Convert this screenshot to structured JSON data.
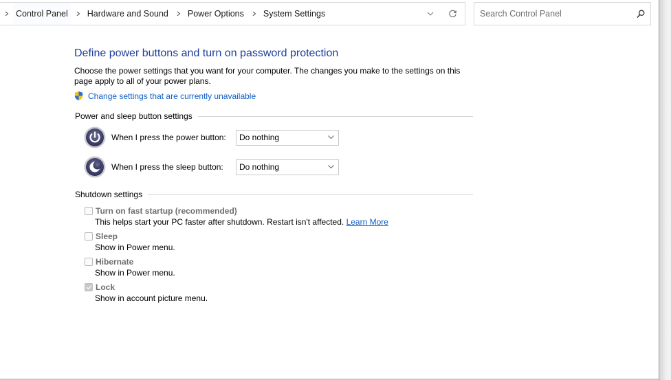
{
  "address_bar": {
    "breadcrumbs": [
      "Control Panel",
      "Hardware and Sound",
      "Power Options",
      "System Settings"
    ],
    "dropdown_icon": "chevron-down-icon",
    "refresh_icon": "refresh-icon"
  },
  "search": {
    "placeholder": "Search Control Panel",
    "value": "",
    "icon": "search-icon"
  },
  "page": {
    "title": "Define power buttons and turn on password protection",
    "description": "Choose the power settings that you want for your computer. The changes you make to the settings on this page apply to all of your power plans.",
    "uac_link": "Change settings that are currently unavailable"
  },
  "power_sleep": {
    "header": "Power and sleep button settings",
    "rows": [
      {
        "icon": "power-button-icon",
        "label": "When I press the power button:",
        "value": "Do nothing"
      },
      {
        "icon": "sleep-button-icon",
        "label": "When I press the sleep button:",
        "value": "Do nothing"
      }
    ]
  },
  "shutdown": {
    "header": "Shutdown settings",
    "items": [
      {
        "label": "Turn on fast startup (recommended)",
        "desc": "This helps start your PC faster after shutdown. Restart isn't affected.",
        "link": "Learn More",
        "checked": false,
        "disabled": true
      },
      {
        "label": "Sleep",
        "desc": "Show in Power menu.",
        "checked": false,
        "disabled": true
      },
      {
        "label": "Hibernate",
        "desc": "Show in Power menu.",
        "checked": false,
        "disabled": true
      },
      {
        "label": "Lock",
        "desc": "Show in account picture menu.",
        "checked": true,
        "disabled": true
      }
    ]
  },
  "colors": {
    "title": "#1e3f9a",
    "link": "#0f5ec6",
    "disabled_text": "#6d6d6d"
  }
}
